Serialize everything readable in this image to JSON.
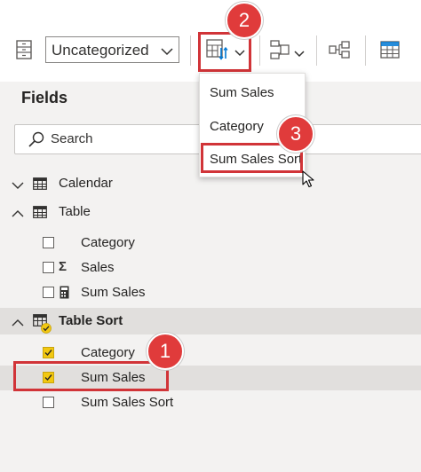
{
  "toolbar": {
    "category_dropdown_value": "Uncategorized",
    "icons": [
      "data-category-icon",
      "sort-by-column-icon",
      "chevron-down-icon",
      "group-icon",
      "chevron-down-icon",
      "manage-relationships-icon",
      "table-icon"
    ]
  },
  "sort_menu": {
    "items": [
      {
        "label": "Sum Sales"
      },
      {
        "label": "Category"
      },
      {
        "label": "Sum Sales Sort"
      }
    ]
  },
  "fields_pane": {
    "title": "Fields",
    "search_placeholder": "Search",
    "tables": [
      {
        "name": "Calendar",
        "expanded": false,
        "fields": []
      },
      {
        "name": "Table",
        "expanded": true,
        "fields": [
          {
            "name": "Category",
            "icon": "none",
            "checked": false
          },
          {
            "name": "Sales",
            "icon": "sigma-icon",
            "checked": false
          },
          {
            "name": "Sum Sales",
            "icon": "calculator-icon",
            "checked": false
          }
        ]
      },
      {
        "name": "Table Sort",
        "expanded": true,
        "fields": [
          {
            "name": "Category",
            "icon": "none",
            "checked": true
          },
          {
            "name": "Sum Sales",
            "icon": "none",
            "checked": true
          },
          {
            "name": "Sum Sales Sort",
            "icon": "none",
            "checked": false
          }
        ]
      }
    ]
  },
  "callouts": [
    {
      "number": "1"
    },
    {
      "number": "2"
    },
    {
      "number": "3"
    }
  ],
  "colors": {
    "callout_red": "#e03b3b",
    "highlight_red": "#d13438",
    "checkbox_yellow": "#f2c811",
    "sort_arrow_blue": "#0078d4"
  }
}
